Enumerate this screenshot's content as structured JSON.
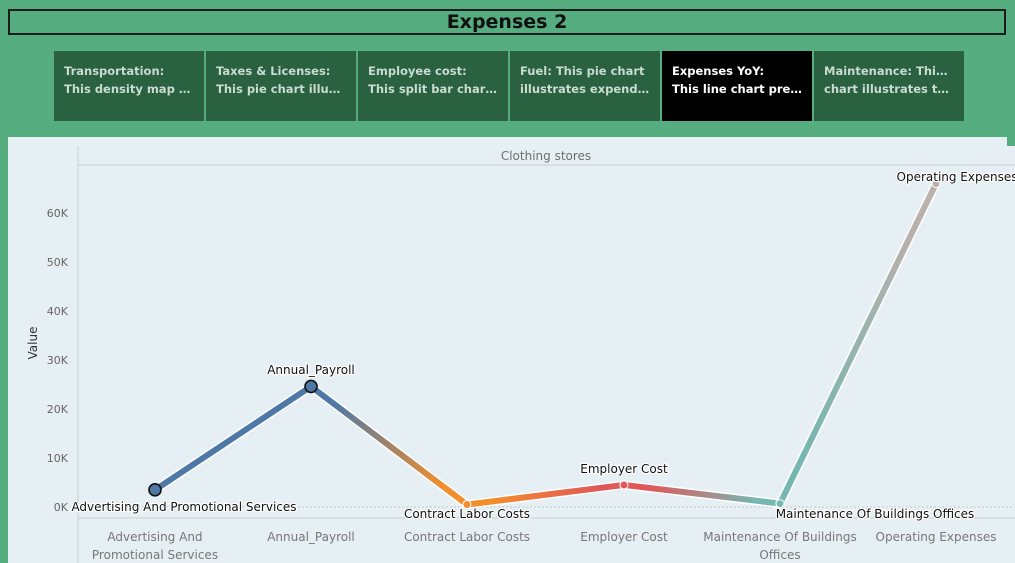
{
  "dashboard": {
    "title": "Expenses 2",
    "story_points": [
      {
        "title": "Transportation:",
        "caption": "This density map tran.."
      },
      {
        "title": "Taxes & Licenses:",
        "caption": "This pie chart  illustra.."
      },
      {
        "title": "Employee cost:",
        "caption": "This split bar chart pr.."
      },
      {
        "title": "Fuel: This pie chart",
        "caption": "illustrates expenditur.."
      },
      {
        "title": "Expenses YoY:",
        "caption": "This line chart presen.."
      },
      {
        "title": "Maintenance: This line",
        "caption": "chart illustrates the e.."
      }
    ],
    "active_story_point": 4
  },
  "chart_data": {
    "type": "line",
    "title": "",
    "panel_header": "Clothing stores",
    "ylabel": "Value",
    "xlabel": "",
    "ylim": [
      0,
      66000
    ],
    "yticks": [
      0,
      10000,
      20000,
      30000,
      40000,
      50000,
      60000
    ],
    "ytick_labels": [
      "0K",
      "10K",
      "20K",
      "30K",
      "40K",
      "50K",
      "60K"
    ],
    "grid": false,
    "categories": [
      "Advertising And Promotional Services",
      "Annual_Payroll",
      "Contract Labor Costs",
      "Employer Cost",
      "Maintenance Of Buildings Offices",
      "Operating Expenses"
    ],
    "category_tick_labels": [
      [
        "Advertising And",
        "Promotional Services"
      ],
      [
        "Annual_Payroll"
      ],
      [
        "Contract Labor Costs"
      ],
      [
        "Employer Cost"
      ],
      [
        "Maintenance Of Buildings",
        "Offices"
      ],
      [
        "Operating Expenses"
      ]
    ],
    "values": [
      3500,
      24600,
      500,
      4500,
      700,
      66000
    ],
    "point_colors": [
      "#4e79a7",
      "#4e79a7",
      "#f28e2b",
      "#e15759",
      "#76b7b2",
      "#bab0ac"
    ],
    "data_labels": [
      "Advertising And Promotional Services",
      "Annual_Payroll",
      "Contract Labor Costs",
      "Employer Cost",
      "Maintenance Of Buildings Offices",
      "Operating Expenses"
    ]
  }
}
